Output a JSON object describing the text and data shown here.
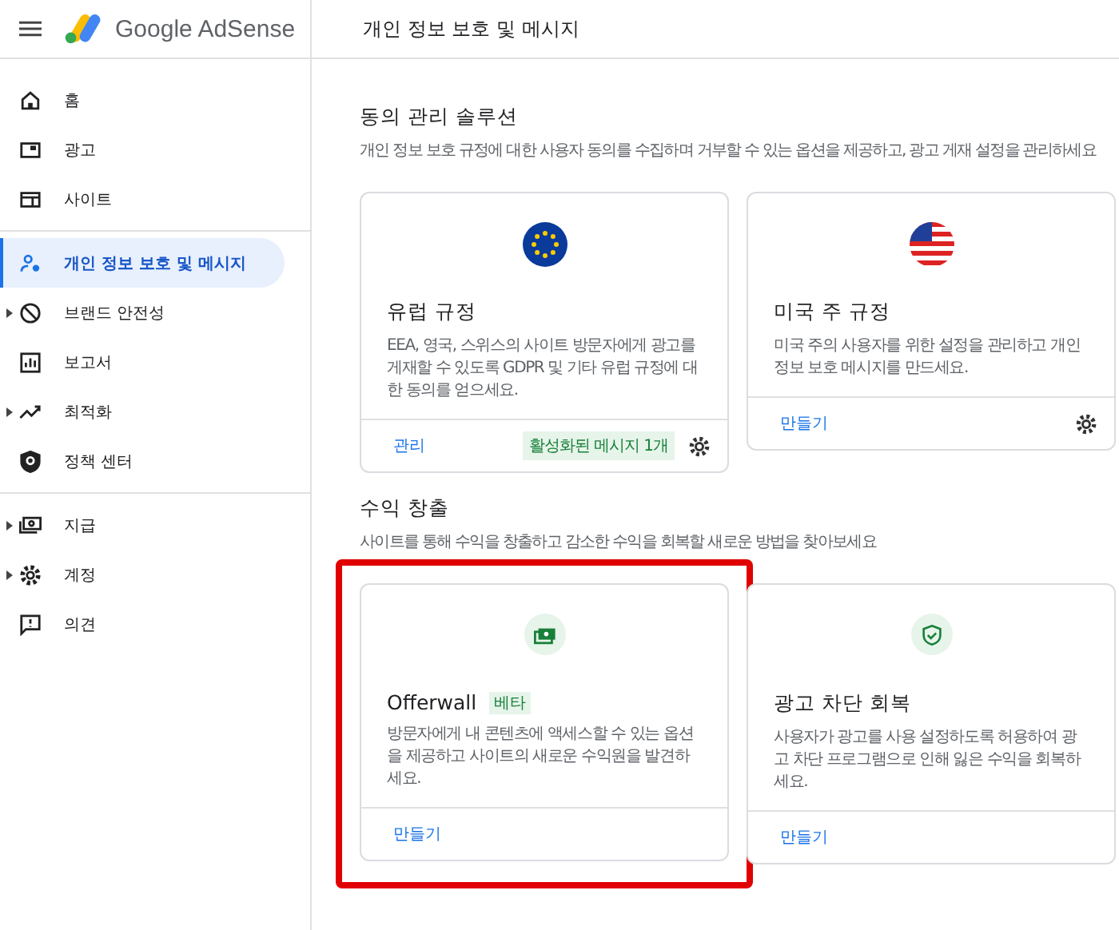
{
  "header": {
    "product": "Google AdSense",
    "page_title": "개인 정보 보호 및 메시지"
  },
  "sidebar": {
    "groups": [
      [
        {
          "label": "홈",
          "expandable": false,
          "selected": false
        },
        {
          "label": "광고",
          "expandable": false,
          "selected": false
        },
        {
          "label": "사이트",
          "expandable": false,
          "selected": false
        }
      ],
      [
        {
          "label": "개인 정보 보호 및 메시지",
          "expandable": false,
          "selected": true
        },
        {
          "label": "브랜드 안전성",
          "expandable": true,
          "selected": false
        },
        {
          "label": "보고서",
          "expandable": false,
          "selected": false
        },
        {
          "label": "최적화",
          "expandable": true,
          "selected": false
        },
        {
          "label": "정책 센터",
          "expandable": false,
          "selected": false
        }
      ],
      [
        {
          "label": "지급",
          "expandable": true,
          "selected": false
        },
        {
          "label": "계정",
          "expandable": true,
          "selected": false
        },
        {
          "label": "의견",
          "expandable": false,
          "selected": false
        }
      ]
    ]
  },
  "sections": [
    {
      "title": "동의 관리 솔루션",
      "description": "개인 정보 보호 규정에 대한 사용자 동의를 수집하며 거부할 수 있는 옵션을 제공하고, 광고 게재 설정을 관리하세요",
      "cards": [
        {
          "title": "유럽 규정",
          "description": "EEA, 영국, 스위스의 사이트 방문자에게 광고를 게재할 수 있도록 GDPR 및 기타 유럽 규정에 대한 동의를 얻으세요.",
          "link": "관리",
          "status": "활성화된 메시지 1개",
          "settings": true,
          "highlighted": false
        },
        {
          "title": "미국 주 규정",
          "description": "미국 주의 사용자를 위한 설정을 관리하고 개인 정보 보호 메시지를 만드세요.",
          "link": "만들기",
          "settings": true,
          "highlighted": false
        }
      ]
    },
    {
      "title": "수익 창출",
      "description": "사이트를 통해 수익을 창출하고 감소한 수익을 회복할 새로운 방법을 찾아보세요",
      "cards": [
        {
          "title": "Offerwall",
          "badge": "베타",
          "description": "방문자에게 내 콘텐츠에 액세스할 수 있는 옵션을 제공하고 사이트의 새로운 수익원을 발견하세요.",
          "link": "만들기",
          "settings": false,
          "highlighted": true
        },
        {
          "title": "광고 차단 회복",
          "description": "사용자가 광고를 사용 설정하도록 허용하여 광고 차단 프로그램으로 인해 잃은 수익을 회복하세요.",
          "link": "만들기",
          "settings": false,
          "highlighted": false
        }
      ]
    }
  ]
}
